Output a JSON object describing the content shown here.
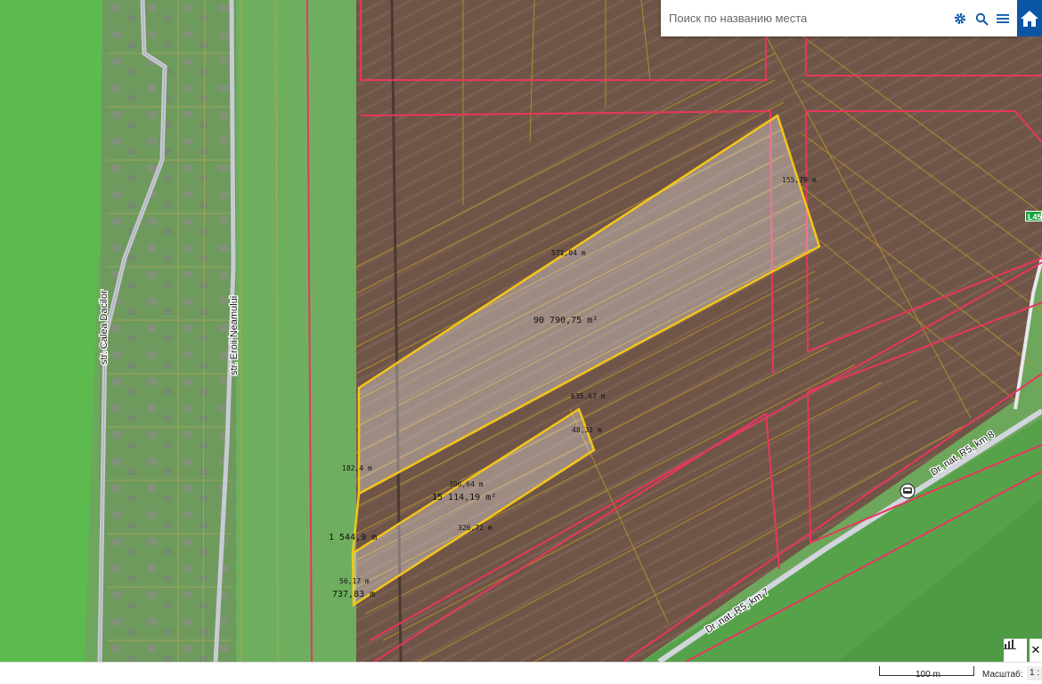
{
  "search": {
    "placeholder": "Поиск по названию места"
  },
  "toolbar": {
    "settings_icon": "gear-icon",
    "search_icon": "search-icon",
    "menu_icon": "menu-icon",
    "home_icon": "home-icon"
  },
  "map": {
    "road_sign": "L45",
    "streets": {
      "calea_dacilor": "str. Calea Dacilor",
      "eroii_neamului": "str. Eroii Neamului",
      "road_km8": "Dr. nat. R5, km 8",
      "road_km7": "Dr. nat. R5, km 7"
    },
    "measurements": {
      "top_edge": "571,04 m",
      "right_edge": "155,79 m",
      "large_area": "90 790,75 m²",
      "long_edge": "635,67 m",
      "small_right_edge": "48,31 m",
      "left_edge": "182,4 m",
      "small_top_edge": "306,64 m",
      "small_area": "15 114,19 m²",
      "small_bottom_edge": "326,72 m",
      "perimeter_small": "1 544,9 m",
      "bottom_left_edge": "56,17 m",
      "perimeter_bottom": "737,83 m"
    },
    "colors": {
      "parcel_highlight": "#f5c518",
      "cadastre_red": "#e8365d",
      "parcel_lines": "#b8952a",
      "green_zone": "#5cba4f"
    }
  },
  "footer": {
    "scale_bar_label": "100 m",
    "scale_title": "Масштаб:",
    "scale_value": "1 :"
  }
}
